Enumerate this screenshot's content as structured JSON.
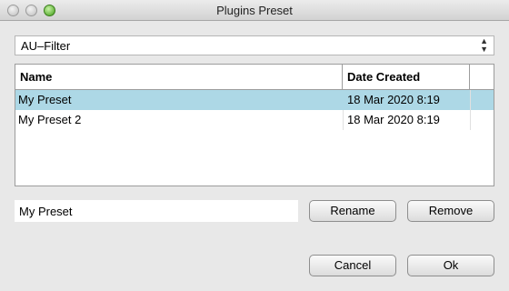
{
  "window": {
    "title": "Plugins Preset"
  },
  "plugin_select": {
    "value": "AU–Filter"
  },
  "table": {
    "columns": [
      "Name",
      "Date Created"
    ],
    "rows": [
      {
        "name": "My Preset",
        "date": "18 Mar 2020 8:19",
        "selected": true
      },
      {
        "name": "My Preset 2",
        "date": "18 Mar 2020 8:19",
        "selected": false
      }
    ]
  },
  "preset_name": {
    "value": "My Preset"
  },
  "buttons": {
    "rename": "Rename",
    "remove": "Remove",
    "cancel": "Cancel",
    "ok": "Ok"
  },
  "colors": {
    "selection": "#add8e6",
    "zoom_button": "#5cb82b"
  },
  "icons": [
    "close-button-icon",
    "minimize-button-icon",
    "zoom-button-icon",
    "updown-chevron-icon"
  ]
}
